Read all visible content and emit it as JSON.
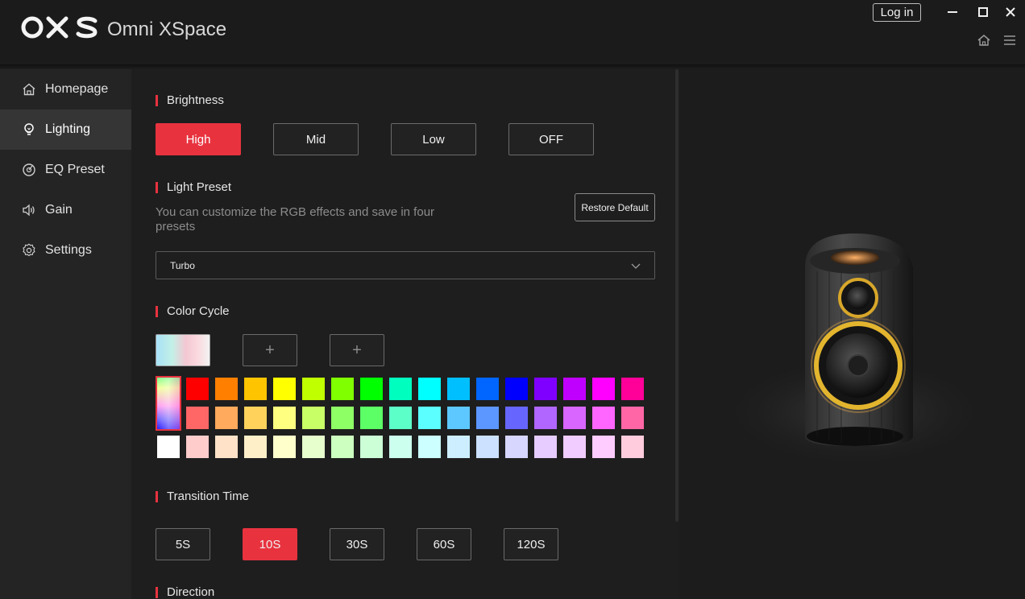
{
  "app": {
    "logo": "OXS",
    "name": "Omni XSpace",
    "login_label": "Log in"
  },
  "sidebar": {
    "items": [
      {
        "label": "Homepage",
        "icon": "home-icon",
        "active": false
      },
      {
        "label": "Lighting",
        "icon": "bulb-icon",
        "active": true
      },
      {
        "label": "EQ Preset",
        "icon": "eq-icon",
        "active": false
      },
      {
        "label": "Gain",
        "icon": "speaker-icon",
        "active": false
      },
      {
        "label": "Settings",
        "icon": "gear-icon",
        "active": false
      }
    ]
  },
  "brightness": {
    "title": "Brightness",
    "options": [
      "High",
      "Mid",
      "Low",
      "OFF"
    ],
    "selected": "High"
  },
  "light_preset": {
    "title": "Light Preset",
    "description": "You can customize the RGB effects and save in four presets",
    "restore_label": "Restore Default",
    "selected": "Turbo"
  },
  "color_cycle": {
    "title": "Color Cycle",
    "slot_add_label": "+",
    "palette": {
      "row1": [
        "#ff0000",
        "#ff7f00",
        "#ffc400",
        "#ffff00",
        "#c0ff00",
        "#80ff00",
        "#00ff00",
        "#00ffbf",
        "#00ffff",
        "#00bfff",
        "#0066ff",
        "#0000ff",
        "#8000ff",
        "#c000ff",
        "#ff00ff",
        "#ff0099"
      ],
      "row2": [
        "#ff6666",
        "#ffaa5c",
        "#ffd25c",
        "#ffff80",
        "#c8ff66",
        "#8fff66",
        "#5cff66",
        "#5cffc8",
        "#5cffff",
        "#5cc8ff",
        "#5c96ff",
        "#6666ff",
        "#b066ff",
        "#d866ff",
        "#ff66ff",
        "#ff66a6"
      ],
      "row3": [
        "#ffffff",
        "#ffcccc",
        "#ffe2c8",
        "#ffefc8",
        "#ffffcc",
        "#e6ffcc",
        "#ccffc0",
        "#ccffd6",
        "#ccffee",
        "#ccffff",
        "#cceeff",
        "#cce0ff",
        "#d6d6ff",
        "#e6ccff",
        "#f0ccff",
        "#ffccff",
        "#ffccdd"
      ]
    }
  },
  "transition_time": {
    "title": "Transition Time",
    "options": [
      "5S",
      "10S",
      "30S",
      "60S",
      "120S"
    ],
    "selected": "10S"
  },
  "direction": {
    "title": "Direction"
  },
  "colors": {
    "accent": "#e8333f",
    "background": "#1e1e1e",
    "sidebar": "#242424"
  }
}
